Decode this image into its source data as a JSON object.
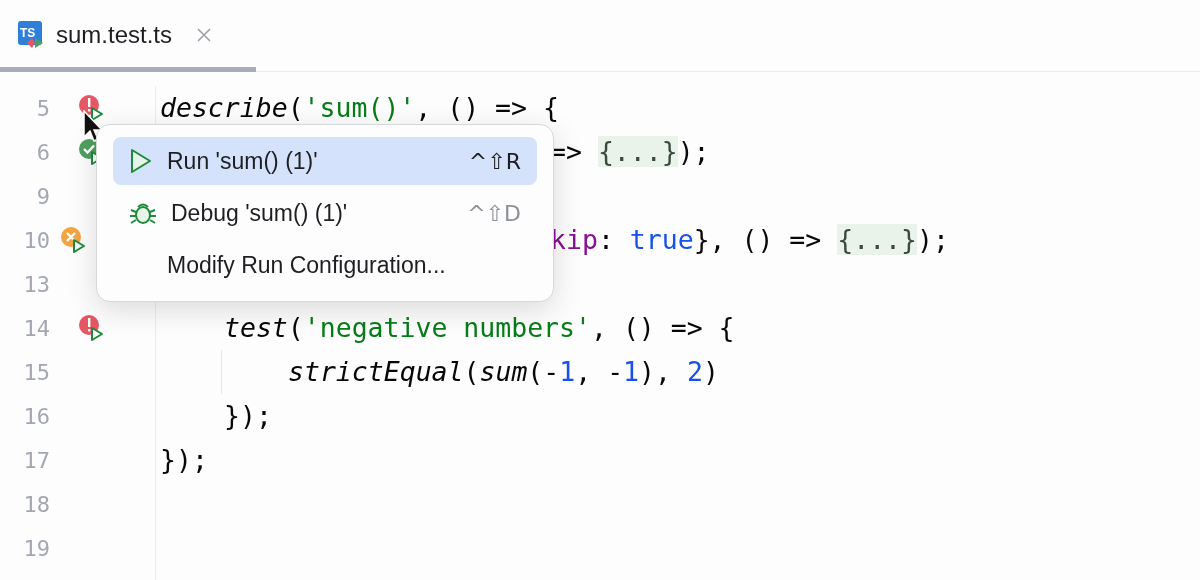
{
  "tab": {
    "title": "sum.test.ts",
    "icon_text": "TS",
    "selected": true
  },
  "lines": [
    {
      "number": "5",
      "gutter_icon": {
        "kind": "failed"
      },
      "kind": "top",
      "segments": [
        {
          "text": "describe",
          "kind": "call"
        },
        {
          "text": "(",
          "kind": "plain"
        },
        {
          "text": "'sum()'",
          "kind": "string"
        },
        {
          "text": ", () => {",
          "kind": "plain"
        }
      ]
    },
    {
      "number": "6",
      "gutter_icon": {
        "kind": "passed"
      },
      "kind": "partial",
      "segments": [
        {
          "text": "=> ",
          "kind": "plain"
        },
        {
          "text": "{...}",
          "kind": "fold"
        },
        {
          "text": ");",
          "kind": "plain"
        }
      ]
    },
    {
      "number": "9",
      "kind": "blank"
    },
    {
      "number": "10",
      "gutter_icon": {
        "kind": "skipped"
      },
      "kind": "partial",
      "segments": [
        {
          "text": "kip",
          "kind": "property"
        },
        {
          "text": ": ",
          "kind": "plain"
        },
        {
          "text": "true",
          "kind": "literal"
        },
        {
          "text": "}, () => ",
          "kind": "plain"
        },
        {
          "text": "{...}",
          "kind": "fold"
        },
        {
          "text": ");",
          "kind": "plain"
        }
      ]
    },
    {
      "number": "13",
      "kind": "blank"
    },
    {
      "number": "14",
      "gutter_icon": {
        "kind": "failed"
      },
      "kind": "block",
      "segments": [
        {
          "text": "test",
          "kind": "call"
        },
        {
          "text": "(",
          "kind": "plain"
        },
        {
          "text": "'negative numbers'",
          "kind": "string"
        },
        {
          "text": ", () => {",
          "kind": "plain"
        }
      ]
    },
    {
      "number": "15",
      "kind": "nested",
      "segments": [
        {
          "text": "strictEqual",
          "kind": "call"
        },
        {
          "text": "(",
          "kind": "plain"
        },
        {
          "text": "sum",
          "kind": "call"
        },
        {
          "text": "(-",
          "kind": "plain"
        },
        {
          "text": "1",
          "kind": "literal"
        },
        {
          "text": ", -",
          "kind": "plain"
        },
        {
          "text": "1",
          "kind": "literal"
        },
        {
          "text": "), ",
          "kind": "plain"
        },
        {
          "text": "2",
          "kind": "literal"
        },
        {
          "text": ")",
          "kind": "plain"
        }
      ]
    },
    {
      "number": "16",
      "kind": "block",
      "segments": [
        {
          "text": "});",
          "kind": "plain"
        }
      ]
    },
    {
      "number": "17",
      "kind": "top",
      "segments": [
        {
          "text": "});",
          "kind": "plain"
        }
      ]
    },
    {
      "number": "18",
      "kind": "blank"
    },
    {
      "number": "19",
      "kind": "blank"
    }
  ],
  "popup": {
    "items": [
      {
        "label": "Run 'sum() (1)'",
        "shortcut": "^⇧R",
        "kind": "run",
        "selected": true
      },
      {
        "label": "Debug 'sum() (1)'",
        "shortcut": "^⇧D",
        "kind": "debug",
        "selected": false
      },
      {
        "label": "Modify Run Configuration...",
        "kind": "plain",
        "selected": false
      }
    ]
  }
}
